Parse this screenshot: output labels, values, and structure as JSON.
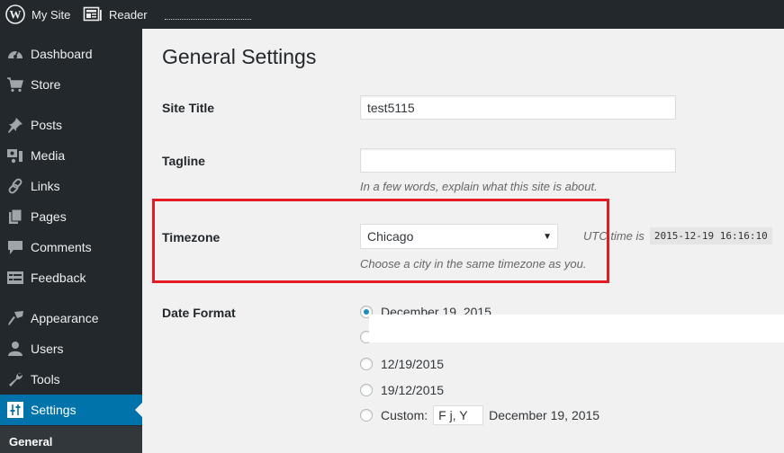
{
  "topbar": {
    "my_site": "My Site",
    "reader": "Reader"
  },
  "sidebar": {
    "items": [
      {
        "label": "Dashboard",
        "icon": "dashboard-icon"
      },
      {
        "label": "Store",
        "icon": "cart-icon"
      },
      {
        "label": "Posts",
        "icon": "pin-icon"
      },
      {
        "label": "Media",
        "icon": "media-icon"
      },
      {
        "label": "Links",
        "icon": "link-icon"
      },
      {
        "label": "Pages",
        "icon": "pages-icon"
      },
      {
        "label": "Comments",
        "icon": "comment-icon"
      },
      {
        "label": "Feedback",
        "icon": "feedback-icon"
      },
      {
        "label": "Appearance",
        "icon": "paintbrush-icon"
      },
      {
        "label": "Users",
        "icon": "user-icon"
      },
      {
        "label": "Tools",
        "icon": "wrench-icon"
      },
      {
        "label": "Settings",
        "icon": "settings-icon",
        "active": true
      }
    ],
    "submenu": [
      "General"
    ]
  },
  "main": {
    "title": "General Settings",
    "site_title": {
      "label": "Site Title",
      "value": "test5115"
    },
    "tagline": {
      "label": "Tagline",
      "value": "",
      "description": "In a few words, explain what this site is about."
    },
    "timezone": {
      "label": "Timezone",
      "selected": "Chicago",
      "description": "Choose a city in the same timezone as you.",
      "utc_label": "UTC time is",
      "utc_value": "2015-12-19 16:16:10"
    },
    "date_format": {
      "label": "Date Format",
      "options": [
        {
          "label": "December 19, 2015",
          "checked": true
        },
        {
          "label": "",
          "checked": false
        },
        {
          "label": "12/19/2015",
          "checked": false
        },
        {
          "label": "19/12/2015",
          "checked": false
        },
        {
          "label": "Custom:",
          "checked": false
        }
      ],
      "custom_value": "F j, Y",
      "custom_preview": "December 19, 2015"
    }
  },
  "colors": {
    "admin_bar": "#23282d",
    "active_menu": "#0073aa",
    "highlight_box": "#e21b24",
    "radio_checked": "#1e8cbe"
  }
}
